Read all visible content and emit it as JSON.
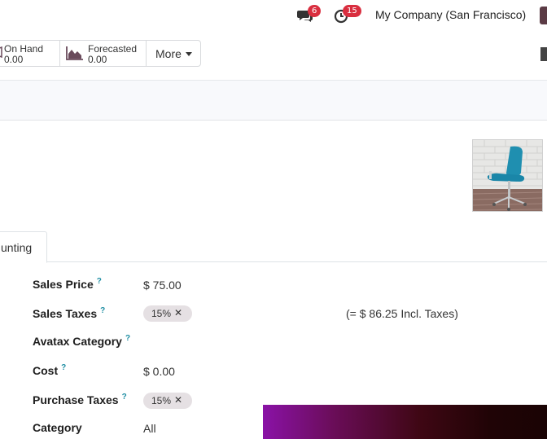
{
  "navbar": {
    "messages_badge": "6",
    "activities_badge": "15",
    "company": "My Company (San Francisco)"
  },
  "stats": {
    "on_hand": {
      "label": "On Hand",
      "value": "0.00"
    },
    "forecasted": {
      "label": "Forecasted",
      "value": "0.00"
    },
    "more_label": "More"
  },
  "tab": {
    "label": "unting"
  },
  "form": {
    "sales_price": {
      "label": "Sales Price",
      "help": "?",
      "value": "$ 75.00"
    },
    "sales_taxes": {
      "label": "Sales Taxes",
      "help": "?",
      "tag": "15%",
      "tag_remove": "✕",
      "incl_taxes": "(= $ 86.25 Incl. Taxes)"
    },
    "avatax_category": {
      "label": "Avatax Category",
      "help": "?"
    },
    "cost": {
      "label": "Cost",
      "help": "?",
      "value": "$ 0.00"
    },
    "purchase_taxes": {
      "label": "Purchase Taxes",
      "help": "?",
      "tag": "15%",
      "tag_remove": "✕"
    },
    "category": {
      "label": "Category",
      "value": "All"
    }
  },
  "colors": {
    "badge": "#d92e3f",
    "help": "#1f8ea3",
    "forecast_icon": "#6a4a5b"
  },
  "icons": {
    "messages": "chat-bubbles-icon",
    "activities": "clock-icon",
    "forecasted": "area-chart-icon",
    "bookmark": "bookmark-icon"
  }
}
